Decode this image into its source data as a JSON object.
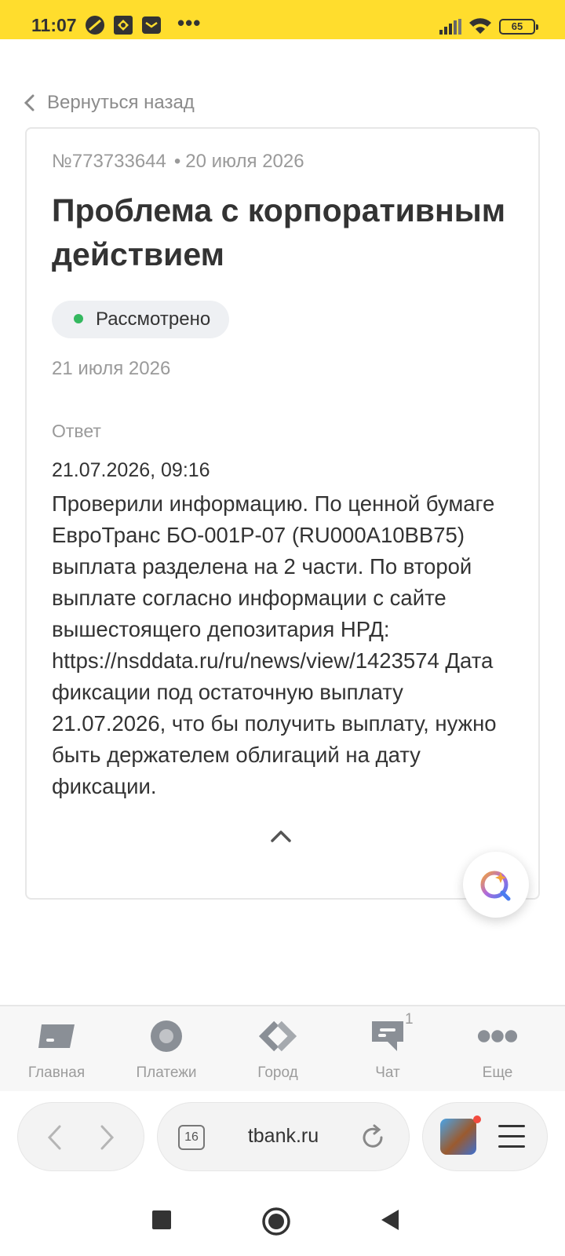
{
  "status_bar": {
    "time": "11:07",
    "battery": "65",
    "icons": [
      "notification-icon",
      "notification-icon",
      "mail-icon",
      "more-dots-icon",
      "signal-icon",
      "wifi-icon",
      "battery-icon"
    ],
    "dots": "•••"
  },
  "back_label": "Вернуться назад",
  "ticket": {
    "number": "№773733644",
    "separator": "•",
    "date": "20 июля 2026",
    "title": "Проблема с корпоративным действием",
    "status": "Рассмотрено",
    "status_color": "#34b85f",
    "resolved_date": "21 июля 2026",
    "answer_label": "Ответ",
    "answer_datetime": "21.07.2026, 09:16",
    "answer_text": "Проверили информацию. По ценной бумаге ЕвроТранс БО-001P-07 (RU000A10BB75) выплата разделена на 2 части. По второй выплате согласно информации с сайте вышестоящего депозитария НРД: https://nsddata.ru/ru/news/view/1423574 Дата фиксации под остаточную выплату 21.07.2026, что бы получить выплату, нужно быть держателем облигаций на дату фиксации."
  },
  "tabbar": {
    "items": [
      {
        "label": "Главная",
        "icon": "home-card-icon"
      },
      {
        "label": "Платежи",
        "icon": "payments-icon"
      },
      {
        "label": "Город",
        "icon": "city-icon"
      },
      {
        "label": "Чат",
        "icon": "chat-icon",
        "count": "1"
      },
      {
        "label": "Еще",
        "icon": "more-icon"
      }
    ]
  },
  "browser": {
    "tabs_count": "16",
    "url": "tbank.ru"
  },
  "colors": {
    "brand_yellow": "#FFDD2D",
    "muted_text": "#9a9a9a",
    "text": "#333333"
  }
}
